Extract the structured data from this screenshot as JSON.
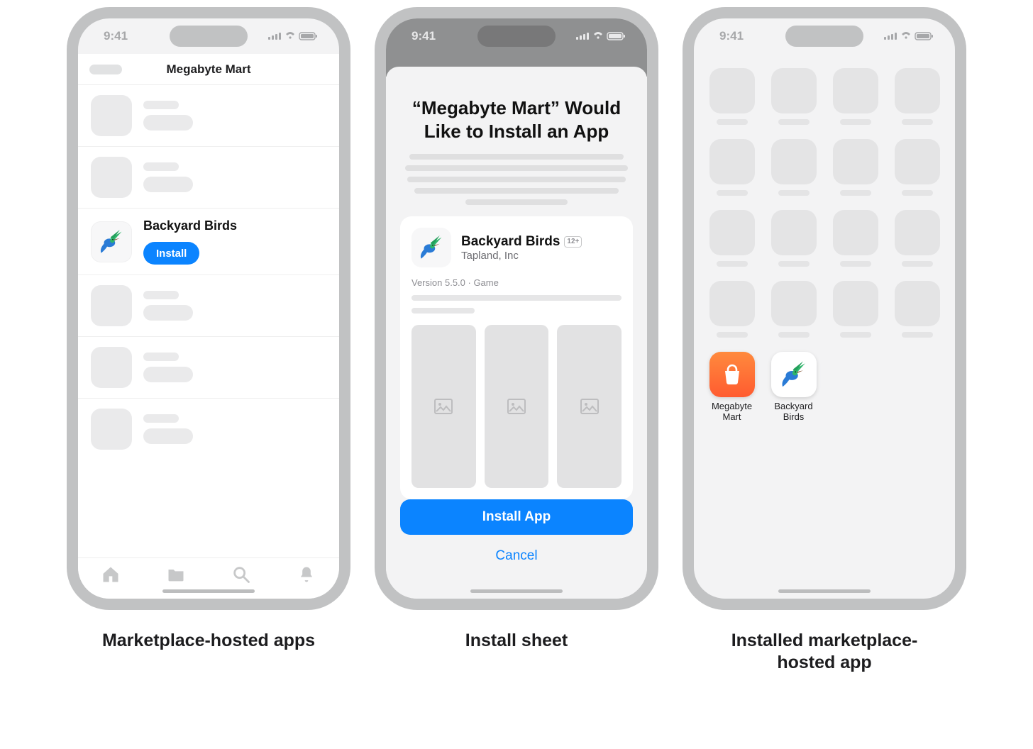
{
  "status": {
    "time": "9:41"
  },
  "captions": {
    "c1": "Marketplace-hosted apps",
    "c2": "Install sheet",
    "c3": "Installed marketplace-hosted app"
  },
  "phone1": {
    "navTitle": "Megabyte Mart",
    "app": {
      "name": "Backyard Birds",
      "installLabel": "Install"
    }
  },
  "phone2": {
    "title": "“Megabyte Mart” Would Like to Install an App",
    "app": {
      "name": "Backyard Birds",
      "developer": "Tapland, Inc",
      "age": "12+",
      "meta": "Version 5.5.0 · Game"
    },
    "installLabel": "Install App",
    "cancelLabel": "Cancel"
  },
  "phone3": {
    "apps": {
      "a1": "Megabyte\nMart",
      "a2": "Backyard\nBirds"
    }
  }
}
